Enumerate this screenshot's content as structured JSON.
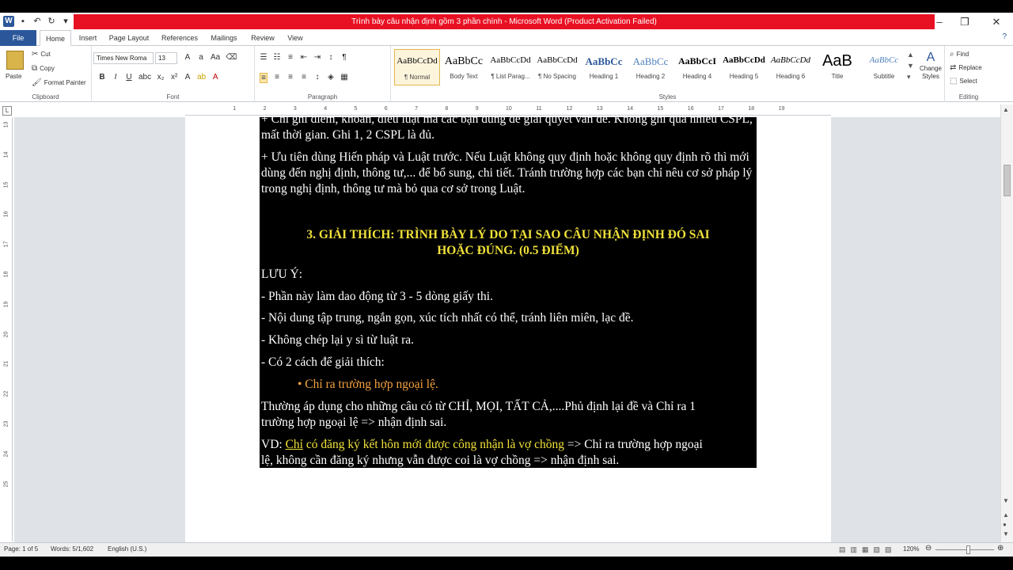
{
  "window": {
    "title": "Trình bày câu nhận định gồm 3 phần chính  -  Microsoft Word (Product Activation Failed)",
    "logo": "W"
  },
  "tabs": [
    "File",
    "Home",
    "Insert",
    "Page Layout",
    "References",
    "Mailings",
    "Review",
    "View"
  ],
  "ribbon": {
    "clipboard": {
      "paste": "Paste",
      "cut": "Cut",
      "copy": "Copy",
      "format_painter": "Format Painter",
      "label": "Clipboard"
    },
    "font": {
      "name": "Times New Roma",
      "size": "13",
      "label": "Font"
    },
    "paragraph": {
      "label": "Paragraph"
    },
    "styles": {
      "label": "Styles",
      "items": [
        {
          "sample": "AaBbCcDd",
          "name": "¶ Normal"
        },
        {
          "sample": "AaBbCc",
          "name": "Body Text"
        },
        {
          "sample": "AaBbCcDd",
          "name": "¶ List Parag..."
        },
        {
          "sample": "AaBbCcDd",
          "name": "¶ No Spacing"
        },
        {
          "sample": "AaBbCc",
          "name": "Heading 1"
        },
        {
          "sample": "AaBbCc",
          "name": "Heading 2"
        },
        {
          "sample": "AaBbCcI",
          "name": "Heading 4"
        },
        {
          "sample": "AaBbCcDd",
          "name": "Heading 5"
        },
        {
          "sample": "AaBbCcDd",
          "name": "Heading 6"
        },
        {
          "sample": "AaB",
          "name": "Title"
        },
        {
          "sample": "AaBbCc",
          "name": "Subtitle"
        }
      ],
      "change_styles": "Change Styles"
    },
    "editing": {
      "find": "Find",
      "replace": "Replace",
      "select": "Select",
      "label": "Editing"
    }
  },
  "document": {
    "p1": "+ Chỉ ghi điểm, khoản, điều luật mà các bạn dùng để giải quyết vấn đề. Không ghi quá nhiều CSPL, mất thời gian. Ghi 1, 2 CSPL là đủ.",
    "p2": "+ Ưu tiên dùng Hiến pháp và Luật trước. Nếu Luật không quy định hoặc không quy định rõ thì mới dùng đến nghị định, thông tư,... để bổ sung, chi tiết. Tránh trường hợp các bạn chỉ nêu cơ sở pháp lý trong nghị định, thông tư mà bỏ qua cơ sở trong Luật.",
    "heading_line1": "3. GIẢI THÍCH: TRÌNH BÀY LÝ DO TẠI SAO CÂU NHẬN ĐỊNH ĐÓ SAI",
    "heading_line2": "HOẶC ĐÚNG. (0.5 ĐIỂM)",
    "luu_y": "LƯU Ý:",
    "l1": "- Phần này làm dao động từ 3 - 5 dòng giấy thi.",
    "l2": "- Nội dung tập trung, ngắn gọn, xúc tích nhất có thể, tránh liên miên, lạc đề.",
    "l3": "- Không chép lại y sì từ luật ra.",
    "l4": "- Có 2 cách để giải thích:",
    "bullet": "• Chỉ ra trường hợp ngoại lệ.",
    "p3_line1": "Thường áp dụng cho những câu có từ CHỈ, MỌI, TẤT CẢ,....Phủ định lại đề và Chỉ ra 1",
    "p3_line2": "trường hợp ngoại lệ => nhận định sai.",
    "vd_prefix": "VD: ",
    "vd_chi": "Chỉ",
    "vd_yellow": " có đăng ký kết hôn mới được công nhận là vợ chồng",
    "vd_rest1": " => Chỉ ra trường hợp ngoại",
    "vd_line2": "lệ, không cần đăng ký nhưng vẫn được coi là vợ chồng => nhận định sai."
  },
  "status": {
    "page": "Page: 1 of 5",
    "words": "Words: 5/1,602",
    "language": "English (U.S.)",
    "zoom": "120%"
  },
  "colors": {
    "title_bar": "#e81123",
    "file_tab": "#2b579a",
    "heading": "#f0e13a",
    "bullet": "#f4a23f"
  }
}
